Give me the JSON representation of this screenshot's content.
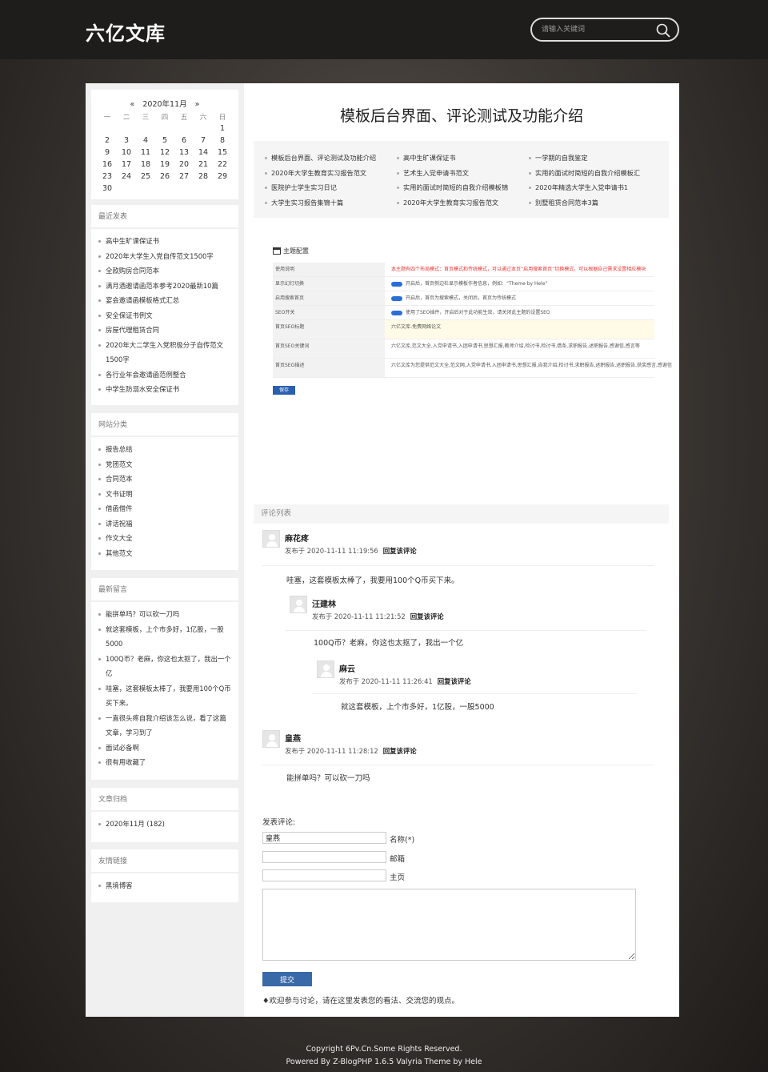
{
  "site": {
    "logo": "六亿文库"
  },
  "search": {
    "placeholder": "请输入关键词"
  },
  "calendar": {
    "month": "2020年11月",
    "prev": "«",
    "next": "»",
    "weekdays": [
      "一",
      "二",
      "三",
      "四",
      "五",
      "六",
      "日"
    ],
    "weeks": [
      [
        "",
        "",
        "",
        "",
        "",
        "",
        "1"
      ],
      [
        "2",
        "3",
        "4",
        "5",
        "6",
        "7",
        "8"
      ],
      [
        "9",
        "10",
        "11",
        "12",
        "13",
        "14",
        "15"
      ],
      [
        "16",
        "17",
        "18",
        "19",
        "20",
        "21",
        "22"
      ],
      [
        "23",
        "24",
        "25",
        "26",
        "27",
        "28",
        "29"
      ],
      [
        "30",
        "",
        "",
        "",
        "",
        "",
        ""
      ]
    ]
  },
  "recent_posts": {
    "title": "最近发表",
    "items": [
      "高中生旷课保证书",
      "2020年大学生入党自传范文1500字",
      "全款购房合同范本",
      "满月酒邀请函范本参考2020最新10篇",
      "宴会邀请函模板格式汇总",
      "安全保证书例文",
      "房屋代理租赁合同",
      "2020年大二学生入党积极分子自传范文1500字",
      "各行业年会邀请函范例整合",
      "中学生防溺水安全保证书"
    ]
  },
  "categories": {
    "title": "网站分类",
    "items": [
      "报告总结",
      "党团范文",
      "合同范本",
      "文书证明",
      "借函借件",
      "讲话祝福",
      "作文大全",
      "其他范文"
    ]
  },
  "recent_comments": {
    "title": "最新留言",
    "items": [
      "能拼单吗？可以砍一刀吗",
      "就这套模板，上个市多好，1亿股，一股5000",
      "100Q币？老麻，你这也太抠了，我出一个亿",
      "哇塞，这套模板太棒了，我要用100个Q币买下来。",
      "一直很头疼自我介绍该怎么说，看了这篇文章，学习到了",
      "面试必备啊",
      "很有用收藏了"
    ]
  },
  "archives": {
    "title": "文章归档",
    "items": [
      "2020年11月 (182)"
    ]
  },
  "links": {
    "title": "友情链接",
    "items": [
      "黑境博客"
    ]
  },
  "post": {
    "title": "模板后台界面、评论测试及功能介绍"
  },
  "related": [
    "模板后台界面、评论测试及功能介绍",
    "高中生旷课保证书",
    "一学期的自我鉴定",
    "2020年大学生教育实习报告范文",
    "艺术生入党申请书范文",
    "实用的面试时简短的自我介绍模板汇",
    "医院护士学生实习日记",
    "实用的面试时简短的自我介绍模板锦",
    "2020年精选大学生入党申请书1",
    "大学生实习报告集锦十篇",
    "2020年大学生教育实习报告范文",
    "别墅租赁合同范本3篇"
  ],
  "theme_config": {
    "heading": "主题配置",
    "rows": [
      {
        "label": "使用说明",
        "value": "本主题有四个布局模式：首页模式和传统模式，可以通过本页“启用搜索首页”切换模式，可以根据自己需求设置相应模块",
        "warn": true
      },
      {
        "label": "显示幻灯切换",
        "value": "开启后，首页侧边栏显示模板作者信息，例如：“Theme by Hele”",
        "toggle": true
      },
      {
        "label": "启用搜索首页",
        "value": "开启后，首页为搜索模式，关闭后，首页为传统模式",
        "toggle": true
      },
      {
        "label": "SEO开关",
        "value": "使用了SEO插件，开启后对于此功能生效，请关闭此主题的设置SEO",
        "toggle": true
      },
      {
        "label": "首页SEO标题",
        "value": "六亿文库-免费网络论文"
      },
      {
        "label": "首页SEO关键词",
        "value": "六亿文库,范文大全,入党申请书,入团申请书,思想汇报,教师介绍,检讨书,检讨书,借条,求职报告,述职报告,感谢信,感言等"
      },
      {
        "label": "首页SEO描述",
        "value": "六亿文库为您提供范文大全,范文网,入党申请书,入团申请书,思想汇报,自我介绍,检讨书,求职报告,述职报告,述职报告,获奖感言,感谢信"
      }
    ],
    "save": "保存"
  },
  "comments": {
    "title": "评论列表",
    "reply_label": "回复该评论",
    "meta_prefix": "发布于",
    "list": [
      {
        "name": "麻花疼",
        "time": "2020-11-11 11:19:56",
        "body": "哇塞，这套模板太棒了，我要用100个Q币买下来。"
      },
      {
        "name": "汪建林",
        "time": "2020-11-11 11:21:52",
        "body": "100Q币？老麻，你这也太抠了，我出一个亿"
      },
      {
        "name": "麻云",
        "time": "2020-11-11 11:26:41",
        "body": "就这套模板，上个市多好，1亿股，一股5000"
      },
      {
        "name": "皇燕",
        "time": "2020-11-11 11:28:12",
        "body": "能拼单吗？可以砍一刀吗"
      }
    ]
  },
  "comment_form": {
    "title": "发表评论:",
    "name_value": "皇燕",
    "name_label": "名称(*)",
    "email_label": "邮箱",
    "home_label": "主页",
    "submit": "提交",
    "note": "♦欢迎参与讨论，请在这里发表您的看法、交流您的观点。"
  },
  "footer": {
    "copyright": "Copyright 6Pv.Cn.Some Rights Reserved.",
    "powered": "Powered By   Z-BlogPHP 1.6.5 Valyria   Theme by   Hele"
  }
}
